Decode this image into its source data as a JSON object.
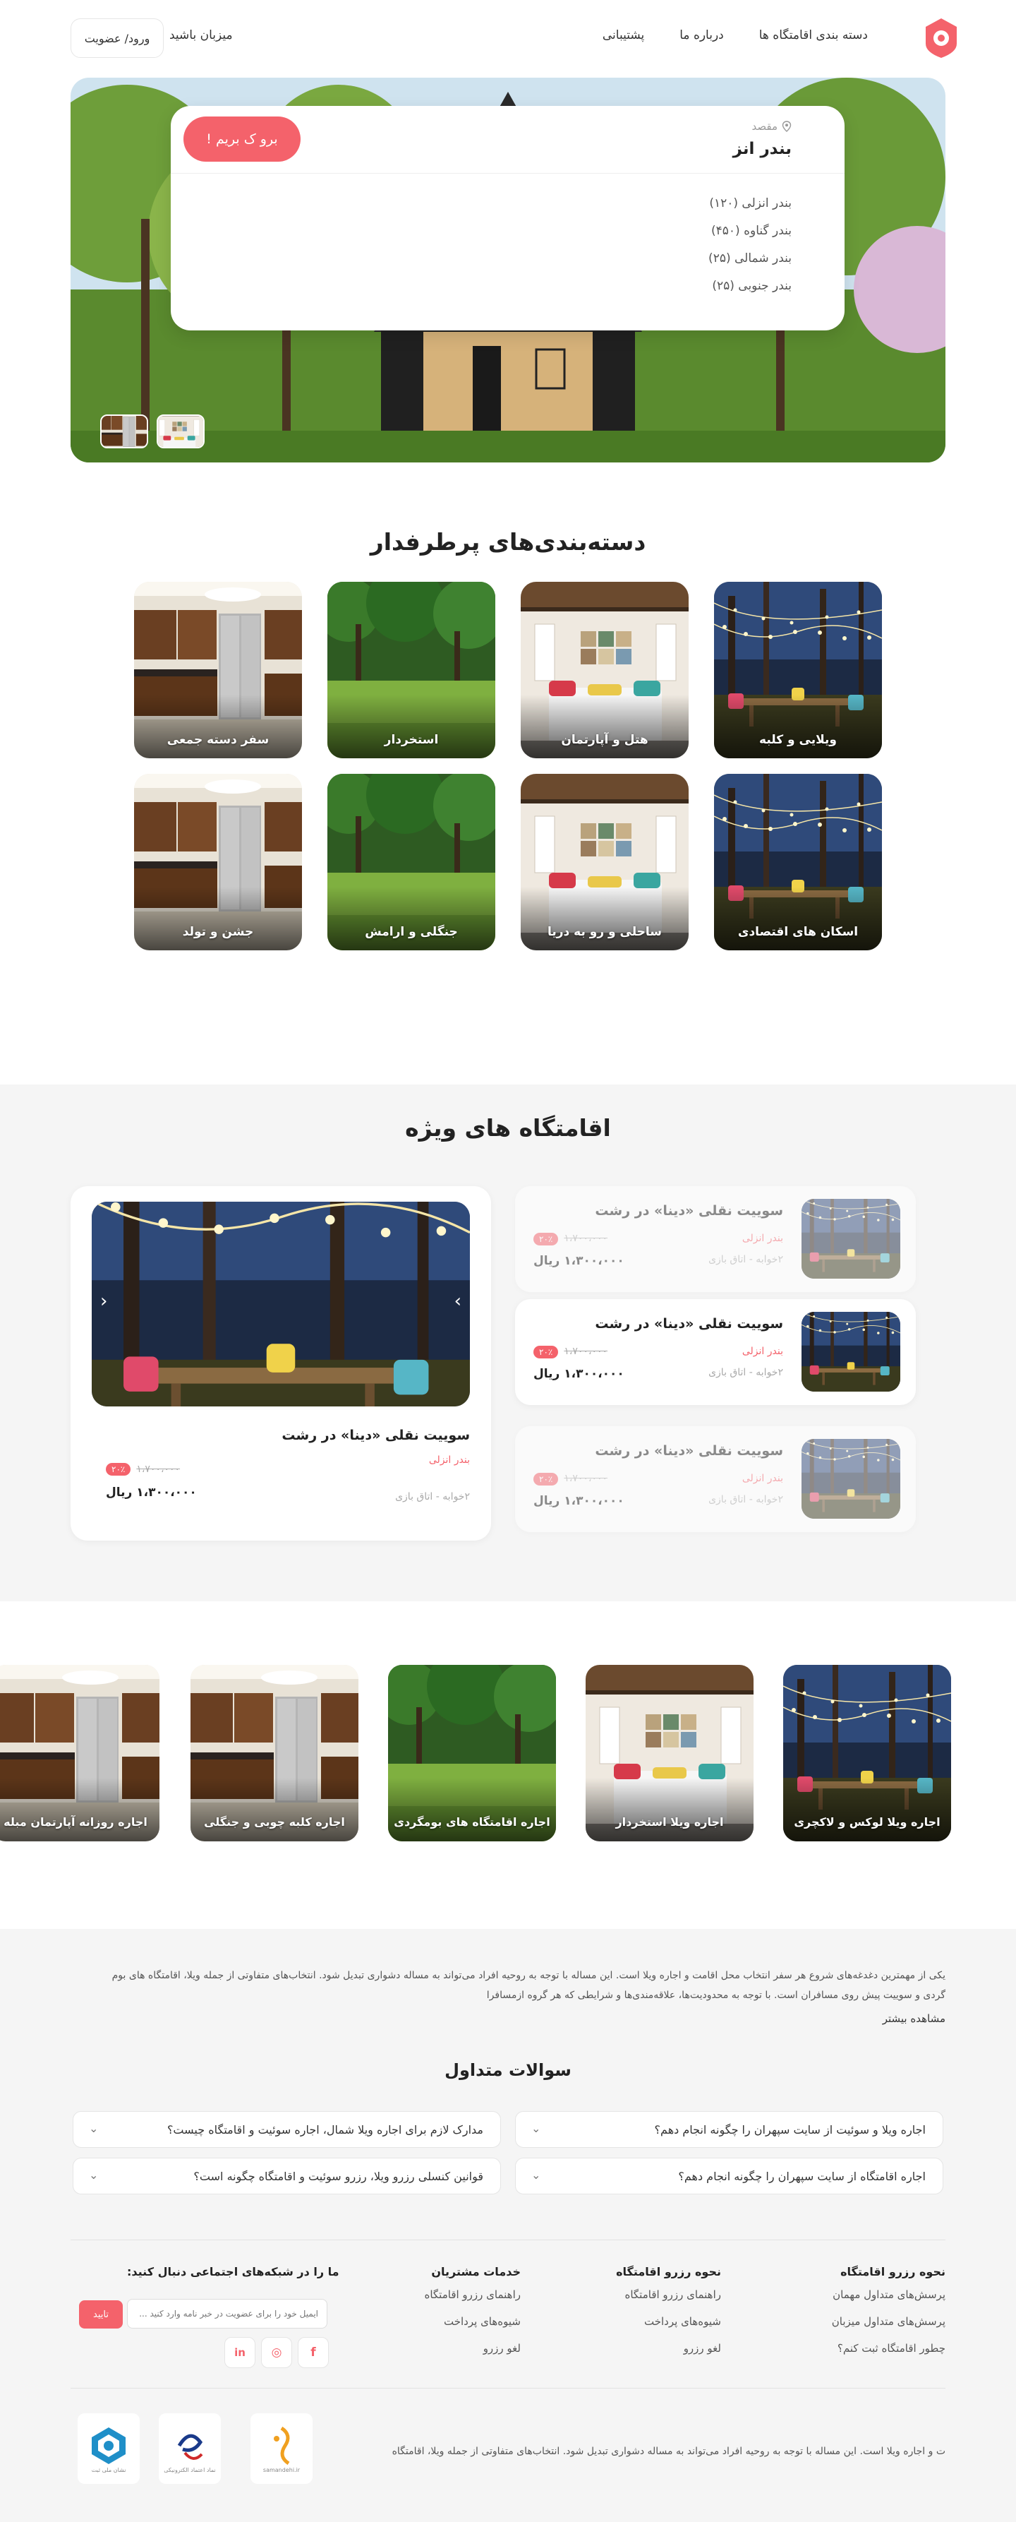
{
  "header": {
    "nav": [
      "دسته بندی اقامتگاه ها",
      "درباره ما",
      "پشتیبانی"
    ],
    "host": "میزبان باشید",
    "login": "ورود/ عضویت"
  },
  "hero": {
    "dest_label": "مقصد",
    "dest_value": "بندر انز",
    "go_button": "برو ک بریم !",
    "options": [
      "بندر انزلی (۱۲۰)",
      "بندر گناوه (۴۵۰)",
      "بندر شمالی (۲۵)",
      "بندر جنوبی (۲۵)"
    ]
  },
  "categories": {
    "title": "دسته‌بندی‌های پرطرفدار",
    "items": [
      "ویلایی و کلبه",
      "هتل و آپارتمان",
      "استخردار",
      "سفر دسته جمعی",
      "اسکان های اقتصادی",
      "ساحلی و رو به دریا",
      "جنگلی و ارامش",
      "جشن و تولد"
    ]
  },
  "special": {
    "title": "اقامتگاه های ویژه",
    "big": {
      "name": "سوییت نقلی «دینا» در رشت",
      "location": "بندر انزلی",
      "meta": "۲خوابه - اتاق بازی",
      "old_price": "۱،۷۰۰،۰۰۰",
      "discount": "۲۰٪",
      "price": "۱،۳۰۰،۰۰۰ ریال"
    },
    "list": [
      {
        "name": "سوییت نقلی «دینا» در رشت",
        "location": "بندر انزلی",
        "meta": "۲خوابه - اتاق بازی",
        "old_price": "۱،۷۰۰،۰۰۰",
        "discount": "۲۰٪",
        "price": "۱،۳۰۰،۰۰۰ ریال"
      },
      {
        "name": "سوییت نقلی «دینا» در رشت",
        "location": "بندر انزلی",
        "meta": "۲خوابه - اتاق بازی",
        "old_price": "۱،۷۰۰،۰۰۰",
        "discount": "۲۰٪",
        "price": "۱،۳۰۰،۰۰۰ ریال"
      },
      {
        "name": "سوییت نقلی «دینا» در رشت",
        "location": "بندر انزلی",
        "meta": "۲خوابه - اتاق بازی",
        "old_price": "۱،۷۰۰،۰۰۰",
        "discount": "۲۰٪",
        "price": "۱،۳۰۰،۰۰۰ ریال"
      }
    ]
  },
  "scroller": [
    "اجاره ویلا لوکس و لاکچری",
    "اجاره ویلا استخردار",
    "اجاره اقامتگاه های بومگردی",
    "اجاره کلبه چوبی و جنگلی",
    "اجاره روزانه آپارتمان مبله"
  ],
  "footer": {
    "intro": "یکی از مهمترین دغدغه‌های شروع هر سفر انتخاب محل اقامت و اجاره ویلا است. این مساله با توجه به روحیه افراد می‌تواند به مساله دشواری تبدیل شود. انتخاب‌های متفاوتی از جمله ویلا، اقامتگاه های بوم گردی و سوییت پیش روی مسافران است. با توجه به محدودیت‌ها، علاقه‌مندی‌ها و شرایطی که هر گروه ازمسافرا",
    "more": "مشاهده بیشتر",
    "faq_title": "سوالات متداول",
    "faq": [
      "اجاره ویلا و سوئیت از سایت سپهران را چگونه انجام دهم؟",
      "مدارک لازم برای اجاره ویلا شمال، اجاره سوئیت و اقامتگاه چیست؟",
      "اجاره اقامتگاه از سایت سپهران را چگونه انجام دهم؟",
      "قوانین کنسلی رزرو ویلا، رزرو سوئیت و اقامتگاه چگونه است؟"
    ],
    "col1": {
      "title": "نحوه رزرو اقامتگاه",
      "items": [
        "پرسش‌های متداول مهمان",
        "پرسش‌های متداول میزبان",
        "چطور اقامتگاه ثبت کنم؟"
      ]
    },
    "col2": {
      "title": "نحوه رزرو اقامتگاه",
      "items": [
        "راهنمای رزرو اقامتگاه",
        "شیوه‌های پرداخت",
        "لغو رزرو"
      ]
    },
    "col3": {
      "title": "خدمات مشتریان",
      "items": [
        "راهنمای رزرو اقامتگاه",
        "شیوه‌های پرداخت",
        "لغو رزرو"
      ]
    },
    "social_title": "ما را در شبکه‌های اجتماعی دنبال کنید:",
    "email_placeholder": "ایمیل خود را برای عضویت در خبر نامه وارد کنید ...",
    "submit": "تایید",
    "social_icons": [
      "f",
      "◎",
      "in"
    ],
    "copyright": "ت و اجاره ویلا است. این مساله با توجه به روحیه افراد می‌تواند به مساله دشواری تبدیل شود. انتخاب‌های متفاوتی از جمله ویلا، اقامتگاه",
    "badges": [
      "samandehi.ir",
      "نماد اعتماد الکترونیکی",
      "نشان ملی ثبت"
    ]
  },
  "colors": {
    "accent": "#f4626b",
    "bg_soft": "#f5f5f5"
  }
}
